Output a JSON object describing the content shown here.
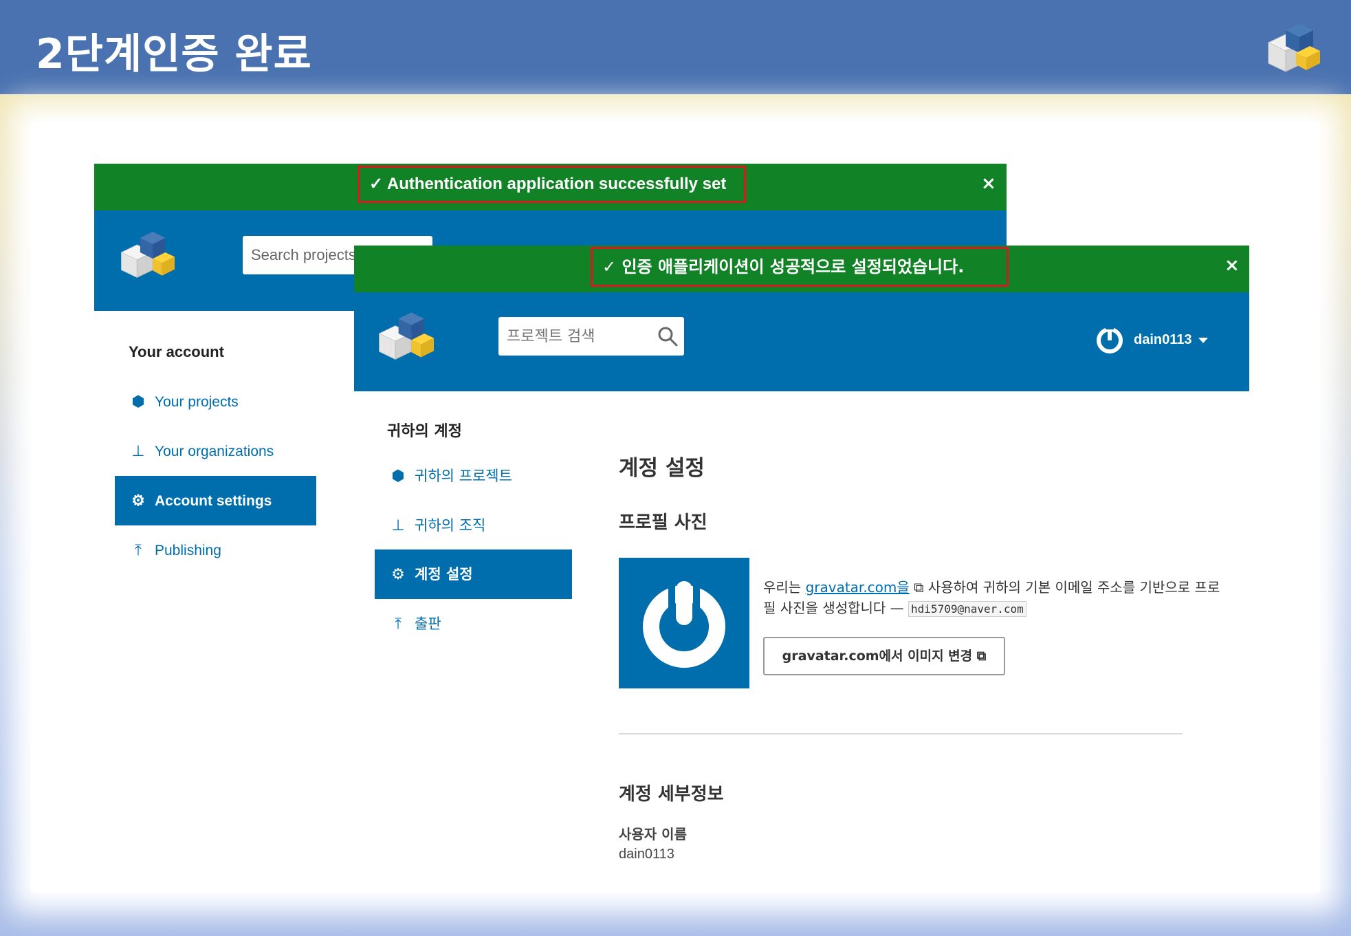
{
  "slide": {
    "title": "2단계인증 완료"
  },
  "english_screen": {
    "flash_message": "Authentication application successfully set up",
    "close_label": "×",
    "search_placeholder": "Search projects",
    "sidebar": {
      "title": "Your account",
      "items": [
        {
          "label": "Your projects",
          "icon": "cubes-icon"
        },
        {
          "label": "Your organizations",
          "icon": "sitemap-icon"
        },
        {
          "label": "Account settings",
          "icon": "gear-icon",
          "active": true
        },
        {
          "label": "Publishing",
          "icon": "upload-icon"
        }
      ]
    }
  },
  "korean_screen": {
    "flash_message": "인증 애플리케이션이 성공적으로 설정되었습니다.",
    "close_label": "×",
    "search_placeholder": "프로젝트 검색",
    "username": "dain0113",
    "sidebar": {
      "title": "귀하의 계정",
      "items": [
        {
          "label": "귀하의 프로젝트",
          "icon": "cubes-icon"
        },
        {
          "label": "귀하의 조직",
          "icon": "sitemap-icon"
        },
        {
          "label": "계정 설정",
          "icon": "gear-icon",
          "active": true
        },
        {
          "label": "출판",
          "icon": "upload-icon"
        }
      ]
    },
    "main": {
      "title": "계정 설정",
      "profile_heading": "프로필 사진",
      "profile_text_prefix": "우리는 ",
      "gravatar_link": "gravatar.com을",
      "profile_text_suffix": " 사용하여 귀하의 기본 이메일 주소를 기반으로 프로필 사진을 생성합니다 — ",
      "email": "hdi5709@naver.com",
      "change_button": "gravatar.com에서 이미지 변경",
      "details_heading": "계정 세부정보",
      "username_label": "사용자 이름",
      "username_value": "dain0113"
    }
  },
  "colors": {
    "slide_header": "#4a72b0",
    "pypi_blue": "#006dad",
    "flash_green": "#128227",
    "highlight_red": "#d71920"
  }
}
